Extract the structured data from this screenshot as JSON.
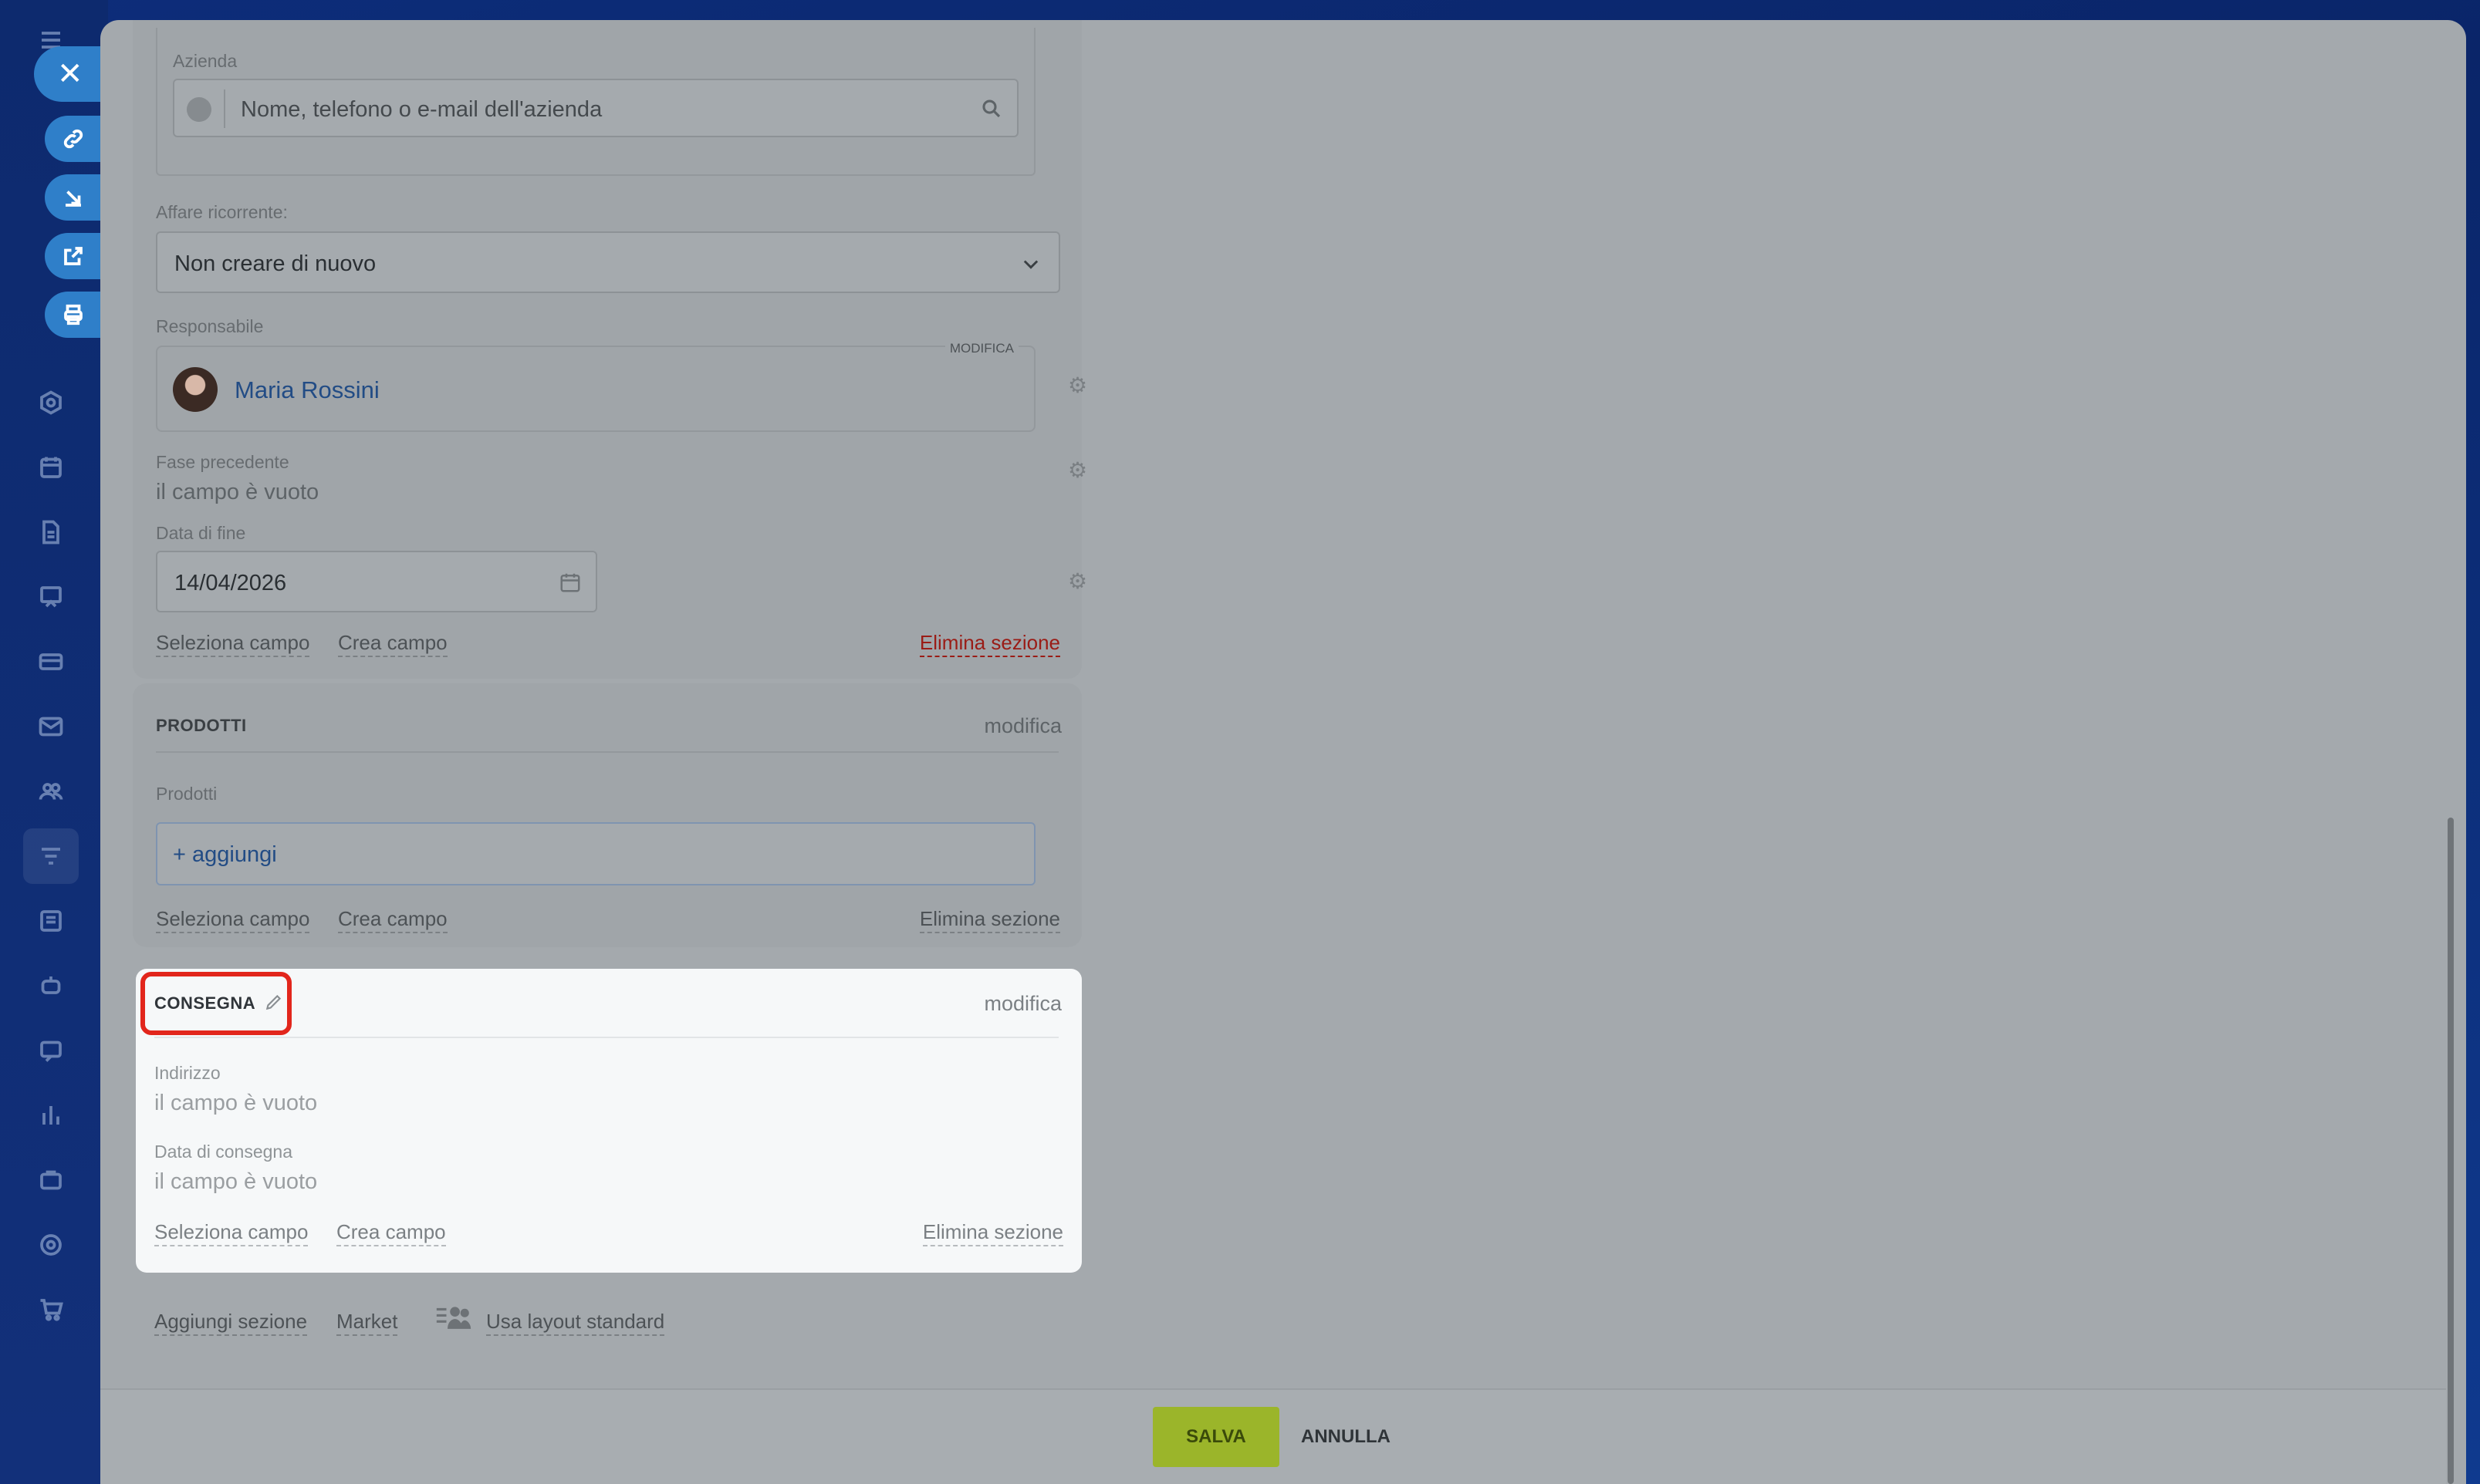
{
  "azienda": {
    "label": "Azienda",
    "placeholder": "Nome, telefono o e-mail dell'azienda"
  },
  "affare": {
    "label": "Affare ricorrente:",
    "value": "Non creare di nuovo"
  },
  "responsabile": {
    "label": "Responsabile",
    "edit_label": "MODIFICA",
    "name": "Maria Rossini"
  },
  "fase": {
    "label": "Fase precedente",
    "value": "il campo è vuoto"
  },
  "data_fine": {
    "label": "Data di fine",
    "value": "14/04/2026"
  },
  "section1_links": {
    "select": "Seleziona campo",
    "create": "Crea campo",
    "delete": "Elimina sezione"
  },
  "prodotti": {
    "title": "PRODOTTI",
    "edit": "modifica",
    "field_label": "Prodotti",
    "add": "+ aggiungi",
    "select": "Seleziona campo",
    "create": "Crea campo",
    "delete": "Elimina sezione"
  },
  "consegna": {
    "title": "CONSEGNA",
    "edit": "modifica",
    "indirizzo_label": "Indirizzo",
    "indirizzo_value": "il campo è vuoto",
    "data_label": "Data di consegna",
    "data_value": "il campo è vuoto",
    "select": "Seleziona campo",
    "create": "Crea campo",
    "delete": "Elimina sezione"
  },
  "bottom_links": {
    "add_section": "Aggiungi sezione",
    "market": "Market",
    "standard_layout": "Usa layout standard"
  },
  "footer": {
    "save": "SALVA",
    "cancel": "ANNULLA"
  },
  "colors": {
    "accent": "#2f7fc9",
    "save": "#9bb52a",
    "danger": "#c0221b",
    "highlight": "#e2261c"
  }
}
